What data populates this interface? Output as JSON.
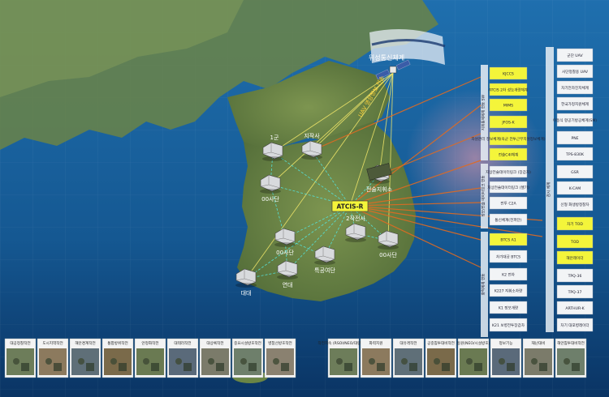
{
  "satellite": {
    "label": "위성통신체계",
    "link_label": "UAV 영상정보 전송"
  },
  "center": {
    "label": "ATCIS-R"
  },
  "nodes": [
    {
      "id": "n-1",
      "label": "1군"
    },
    {
      "id": "n-hq",
      "label": "지작사"
    },
    {
      "id": "n-corps",
      "label": "00사단"
    },
    {
      "id": "n-signal",
      "label": "전술지휘소"
    },
    {
      "id": "n-div",
      "label": "00사단"
    },
    {
      "id": "n-2op",
      "label": "2작전사"
    },
    {
      "id": "n-maint",
      "label": "특공여단"
    },
    {
      "id": "n-yeondae",
      "label": "연대"
    },
    {
      "id": "n-daedae",
      "label": "대대"
    },
    {
      "id": "n-00div-east",
      "label": "00사단"
    }
  ],
  "left_column": {
    "group_labels": [
      "지휘통제체계 연동 SW",
      "정보/전술 데이터링크 연동",
      "화력체계 연동"
    ],
    "items": [
      {
        "label": "KJCCS",
        "style": "yellow"
      },
      {
        "label": "ATCIS 2차 성능개량체계",
        "style": "yellow"
      },
      {
        "label": "MIMS",
        "style": "yellow"
      },
      {
        "label": "JFOS-K",
        "style": "yellow"
      },
      {
        "label": "자원관리 정보체계(육군 전투근무지원정보체계)",
        "style": "yellow"
      },
      {
        "label": "전술C4I체계",
        "style": "yellow"
      },
      {
        "label": "지상전술데이터링크 (장갑차)",
        "style": "white"
      },
      {
        "label": "지상전술데이터링크 (헬기)",
        "style": "white"
      },
      {
        "label": "전투 C2A",
        "style": "white"
      },
      {
        "label": "통신체계(전파단)",
        "style": "white"
      },
      {
        "label": "BTCS A1",
        "style": "yellow"
      },
      {
        "label": "차기대공 BTCS",
        "style": "white"
      },
      {
        "label": "K2 전차",
        "style": "white"
      },
      {
        "label": "K227 지휘소차량",
        "style": "white"
      },
      {
        "label": "K1 정보개량",
        "style": "white"
      },
      {
        "label": "K21 보병전투장갑차",
        "style": "white"
      }
    ]
  },
  "right_column": {
    "group_label": "감시 체계",
    "items": [
      {
        "label": "군단 UAV",
        "style": "white"
      },
      {
        "label": "사단정찰용 UAV",
        "style": "white"
      },
      {
        "label": "차기전차진지체계",
        "style": "white"
      },
      {
        "label": "한국가정지원체계",
        "style": "white"
      },
      {
        "label": "이동식 항공기방공체계(SM)",
        "style": "white"
      },
      {
        "label": "PNE",
        "style": "white"
      },
      {
        "label": "TPS-830K",
        "style": "white"
      },
      {
        "label": "GSR",
        "style": "white"
      },
      {
        "label": "K-CAM",
        "style": "white"
      },
      {
        "label": "신형 화생방정찰차",
        "style": "white"
      },
      {
        "label": "차기 TOD",
        "style": "yellow"
      },
      {
        "label": "TOD",
        "style": "yellow"
      },
      {
        "label": "해안레이더",
        "style": "yellow"
      },
      {
        "label": "TPQ-36",
        "style": "white"
      },
      {
        "label": "TPQ-37",
        "style": "white"
      },
      {
        "label": "ARTHUR-K",
        "style": "white"
      },
      {
        "label": "차기 대포병레이더",
        "style": "white"
      }
    ]
  },
  "bottom_left_thumbs": [
    "대공정찰작전",
    "도시지역작전",
    "해안경계작전",
    "통합방위작전",
    "안정화작전",
    "대테러작전",
    "대상륙작전",
    "중요시설방호작전",
    "병참선방호작전"
  ],
  "bottom_right_thumbs": [
    "작전지속 (RSOI/NEO/대량살상)",
    "화력지원",
    "대유격작전",
    "공중침투대비작전",
    "동원(NEO/시설방호)",
    "정보기능",
    "재난대비",
    "해안침투대비작전"
  ],
  "colors": {
    "sea_top": "#1c6aa8",
    "sea_bottom": "#0b3767",
    "land": "#6f8a4a",
    "yellow_box": "#f4f53a",
    "white_box": "#f2f4f6",
    "orange_link": "#e06a21",
    "satellite_beam": "#f2e86a",
    "net_link": "#55e0d6"
  }
}
